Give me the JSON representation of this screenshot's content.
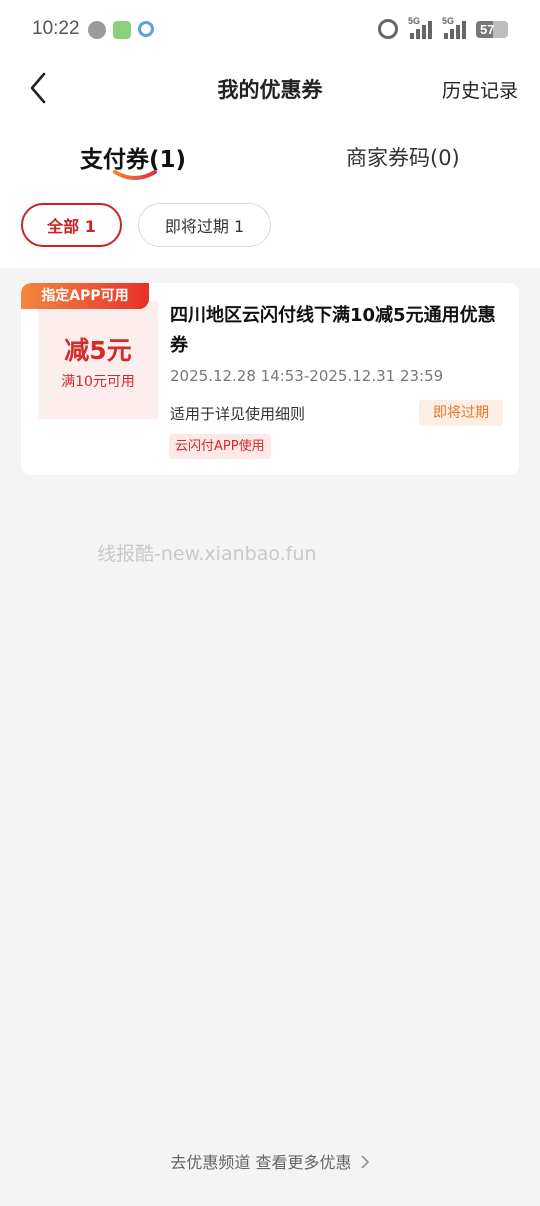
{
  "status_bar": {
    "time": "10:22",
    "network_1": "5G",
    "network_2": "5G",
    "battery": "57",
    "icons": [
      "wechat-icon",
      "green-app-icon",
      "browser-icon",
      "alarm-icon",
      "signal-icon",
      "signal-icon",
      "battery-icon"
    ]
  },
  "header": {
    "title": "我的优惠券",
    "history": "历史记录"
  },
  "tabs": [
    {
      "label": "支付券(1)",
      "active": true
    },
    {
      "label": "商家券码(0)",
      "active": false
    }
  ],
  "filters": [
    {
      "label": "全部 1",
      "active": true
    },
    {
      "label": "即将过期 1",
      "active": false
    }
  ],
  "coupon": {
    "corner_tag": "指定APP可用",
    "amount": "减5元",
    "condition": "满10元可用",
    "title": "四川地区云闪付线下满10减5元通用优惠券",
    "valid_period": "2025.12.28 14:53-2025.12.31 23:59",
    "rule": "适用于详见使用细则",
    "status_badge": "即将过期",
    "app_tag": "云闪付APP使用"
  },
  "watermark": "线报酷-new.xianbao.fun",
  "footer": {
    "link": "去优惠频道 查看更多优惠"
  },
  "colors": {
    "accent": "#c92323",
    "badge_orange": "#e4762b",
    "background": "#f4f4f4"
  }
}
